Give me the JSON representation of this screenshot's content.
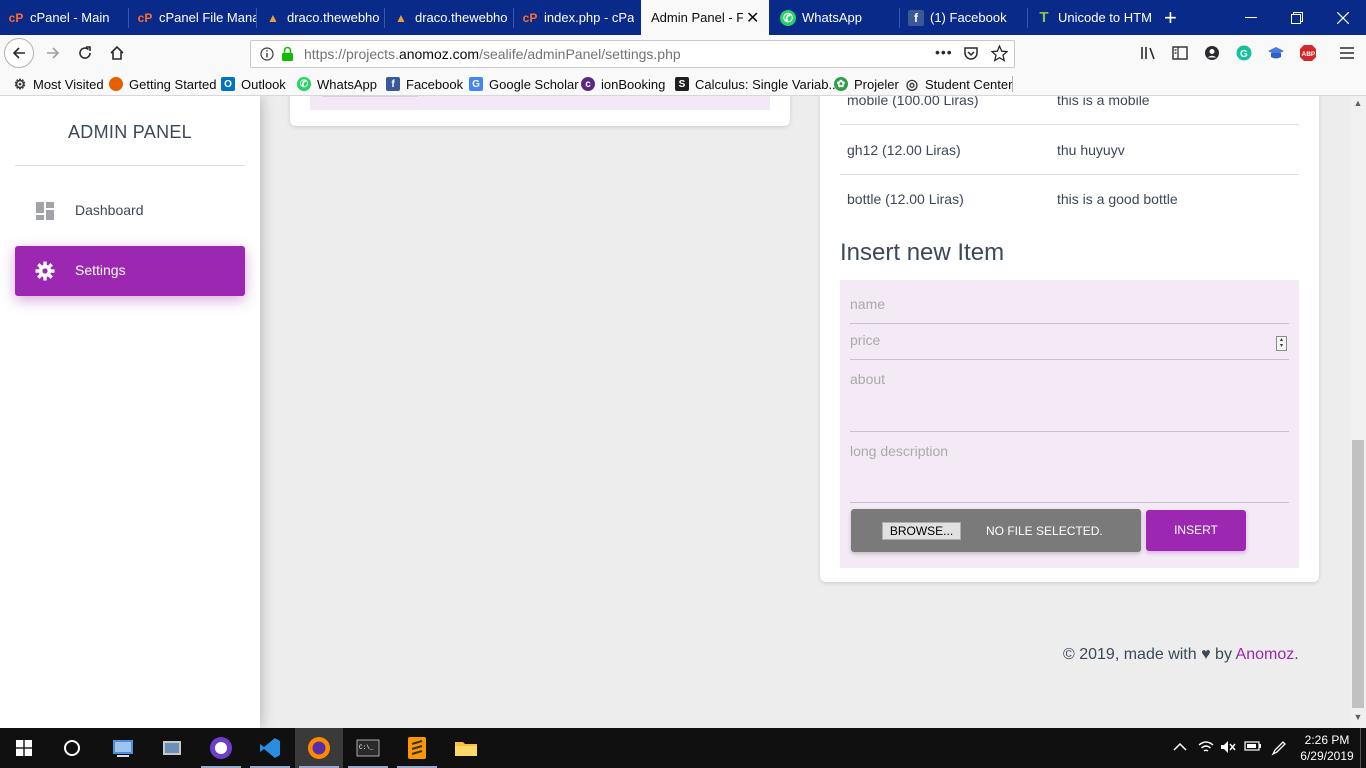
{
  "browser": {
    "tabs": [
      {
        "label": "cPanel - Main",
        "icon": "cpanel-icon",
        "icon_color": "#ff6c2c"
      },
      {
        "label": "cPanel File Mana",
        "icon": "cpanel-icon",
        "icon_color": "#ff6c2c"
      },
      {
        "label": "draco.thewebho",
        "icon": "triangle-logo-icon",
        "icon_color": "#e9a03b"
      },
      {
        "label": "draco.thewebho",
        "icon": "triangle-logo-icon",
        "icon_color": "#e9a03b"
      },
      {
        "label": "index.php - cPa",
        "icon": "cpanel-icon",
        "icon_color": "#ff6c2c"
      },
      {
        "label": "Admin Panel - Fil",
        "icon": "",
        "icon_color": "",
        "active": true
      },
      {
        "label": "WhatsApp",
        "icon": "whatsapp-icon",
        "icon_color": "#25d366"
      },
      {
        "label": "(1) Facebook",
        "icon": "facebook-icon",
        "icon_color": "#3b5998"
      },
      {
        "label": "Unicode to HTM",
        "icon": "unicode-t-icon",
        "icon_color": "#8bc34a"
      }
    ],
    "new_tab_glyph": "+",
    "url": {
      "prefix": "https://projects.",
      "domain": "anomoz.com",
      "path": "/sealife/adminPanel/settings.php"
    },
    "url_actions": {
      "more": "•••"
    },
    "bookmarks": [
      {
        "label": "Most Visited",
        "icon": "gear-icon",
        "color": "#3a3a3a"
      },
      {
        "label": "Getting Started",
        "icon": "firefox-icon",
        "color": "#e66000"
      },
      {
        "label": "Outlook",
        "icon": "outlook-icon",
        "color": "#0072c6"
      },
      {
        "label": "WhatsApp",
        "icon": "whatsapp-icon",
        "color": "#25d366"
      },
      {
        "label": "Facebook",
        "icon": "facebook-icon",
        "color": "#3b5998"
      },
      {
        "label": "Google Scholar",
        "icon": "scholar-icon",
        "color": "#4285f4"
      },
      {
        "label": "ionBooking",
        "icon": "ion-icon",
        "color": "#5a2a82"
      },
      {
        "label": "Calculus: Single Variab...",
        "icon": "s-logo-icon",
        "color": "#1f1f1f"
      },
      {
        "label": "Projeler",
        "icon": "projeler-icon",
        "color": "#2e9e4a"
      },
      {
        "label": "Student Center",
        "icon": "globe-icon",
        "color": "#3a3a3a"
      }
    ]
  },
  "sidebar": {
    "brand": "ADMIN PANEL",
    "items": [
      {
        "label": "Dashboard",
        "icon": "dashboard-icon",
        "active": false
      },
      {
        "label": "Settings",
        "icon": "gear-icon",
        "active": true
      }
    ]
  },
  "items_table": {
    "rows": [
      {
        "name": "mobile (100.00 Liras)",
        "about": "this is a mobile"
      },
      {
        "name": "gh12 (12.00 Liras)",
        "about": "thu huyuyv"
      },
      {
        "name": "bottle (12.00 Liras)",
        "about": "this is a good bottle"
      }
    ]
  },
  "insert_form": {
    "title": "Insert new Item",
    "name_placeholder": "name",
    "price_placeholder": "price",
    "about_placeholder": "about",
    "long_description_placeholder": "long description",
    "browse_label": "BROWSE...",
    "file_status": "NO FILE SELECTED.",
    "insert_label": "INSERT"
  },
  "footer": {
    "prefix": "© 2019, made with",
    "heart": "♥",
    "by": "by",
    "link": "Anomoz",
    "suffix": "."
  },
  "taskbar": {
    "time": "2:26 PM",
    "date": "6/29/2019"
  },
  "colors": {
    "accent": "#9c27b0",
    "tabbar": "#0a2a8a",
    "form_bg": "#f3eaf5"
  }
}
